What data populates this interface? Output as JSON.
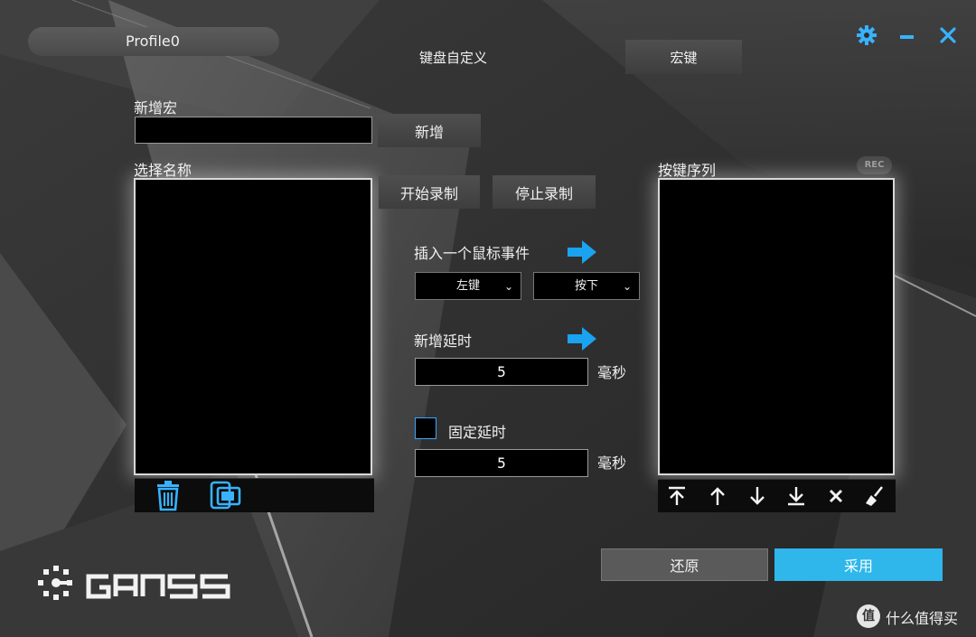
{
  "app": {
    "profile_name": "Profile0",
    "tab_keyboard": "键盘自定义",
    "tab_macro": "宏键",
    "brand": "GANSS"
  },
  "macro_panel": {
    "new_macro_label": "新增宏",
    "new_macro_value": "",
    "add_button": "新增",
    "select_name_label": "选择名称"
  },
  "record": {
    "start_button": "开始录制",
    "stop_button": "停止录制"
  },
  "mouse_event": {
    "label": "插入一个鼠标事件",
    "button_select": "左键",
    "action_select": "按下"
  },
  "delay": {
    "label": "新增延时",
    "value": "5",
    "unit": "毫秒"
  },
  "fixed_delay": {
    "label": "固定延时",
    "checked": false,
    "value": "5",
    "unit": "毫秒"
  },
  "sequence": {
    "label": "按键序列",
    "rec_badge": "REC"
  },
  "footer": {
    "restore_button": "还原",
    "apply_button": "采用"
  },
  "watermark": {
    "badge": "值",
    "text": "什么值得买"
  },
  "icons": {
    "settings": "gear-icon",
    "minimize": "minimize-icon",
    "close": "close-icon",
    "delete": "trash-icon",
    "copy": "copy-icon",
    "seq_tools": [
      "move-top-icon",
      "move-up-icon",
      "move-down-icon",
      "move-bottom-icon",
      "delete-icon",
      "clear-icon"
    ]
  },
  "colors": {
    "accent": "#2fb6ea",
    "icon_blue": "#38b2ff",
    "arrow_blue": "#19a3f0"
  }
}
